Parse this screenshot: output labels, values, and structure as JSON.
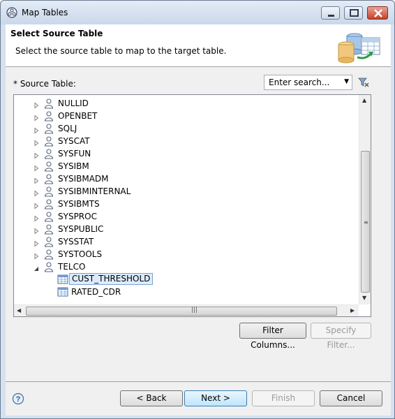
{
  "window": {
    "title": "Map Tables"
  },
  "banner": {
    "title": "Select Source Table",
    "description": "Select the source table to map to the target table."
  },
  "source": {
    "label": "* Source Table:",
    "search_placeholder": "Enter search..."
  },
  "tree": {
    "schemas": [
      {
        "label": "NULLID",
        "expanded": false
      },
      {
        "label": "OPENBET",
        "expanded": false
      },
      {
        "label": "SQLJ",
        "expanded": false
      },
      {
        "label": "SYSCAT",
        "expanded": false
      },
      {
        "label": "SYSFUN",
        "expanded": false
      },
      {
        "label": "SYSIBM",
        "expanded": false
      },
      {
        "label": "SYSIBMADM",
        "expanded": false
      },
      {
        "label": "SYSIBMINTERNAL",
        "expanded": false
      },
      {
        "label": "SYSIBMTS",
        "expanded": false
      },
      {
        "label": "SYSPROC",
        "expanded": false
      },
      {
        "label": "SYSPUBLIC",
        "expanded": false
      },
      {
        "label": "SYSSTAT",
        "expanded": false
      },
      {
        "label": "SYSTOOLS",
        "expanded": false
      },
      {
        "label": "TELCO",
        "expanded": true
      }
    ],
    "tables": [
      {
        "label": "CUST_THRESHOLD",
        "selected": true
      },
      {
        "label": "RATED_CDR",
        "selected": false
      }
    ]
  },
  "buttons": {
    "filter_columns": "Filter Columns...",
    "specify_filter": "Specify Filter...",
    "back": "< Back",
    "next": "Next >",
    "finish": "Finish",
    "cancel": "Cancel"
  },
  "colors": {
    "selection_bg": "#dcebfc",
    "selection_border": "#7da2ce",
    "client_bg": "#f0f0f0"
  }
}
